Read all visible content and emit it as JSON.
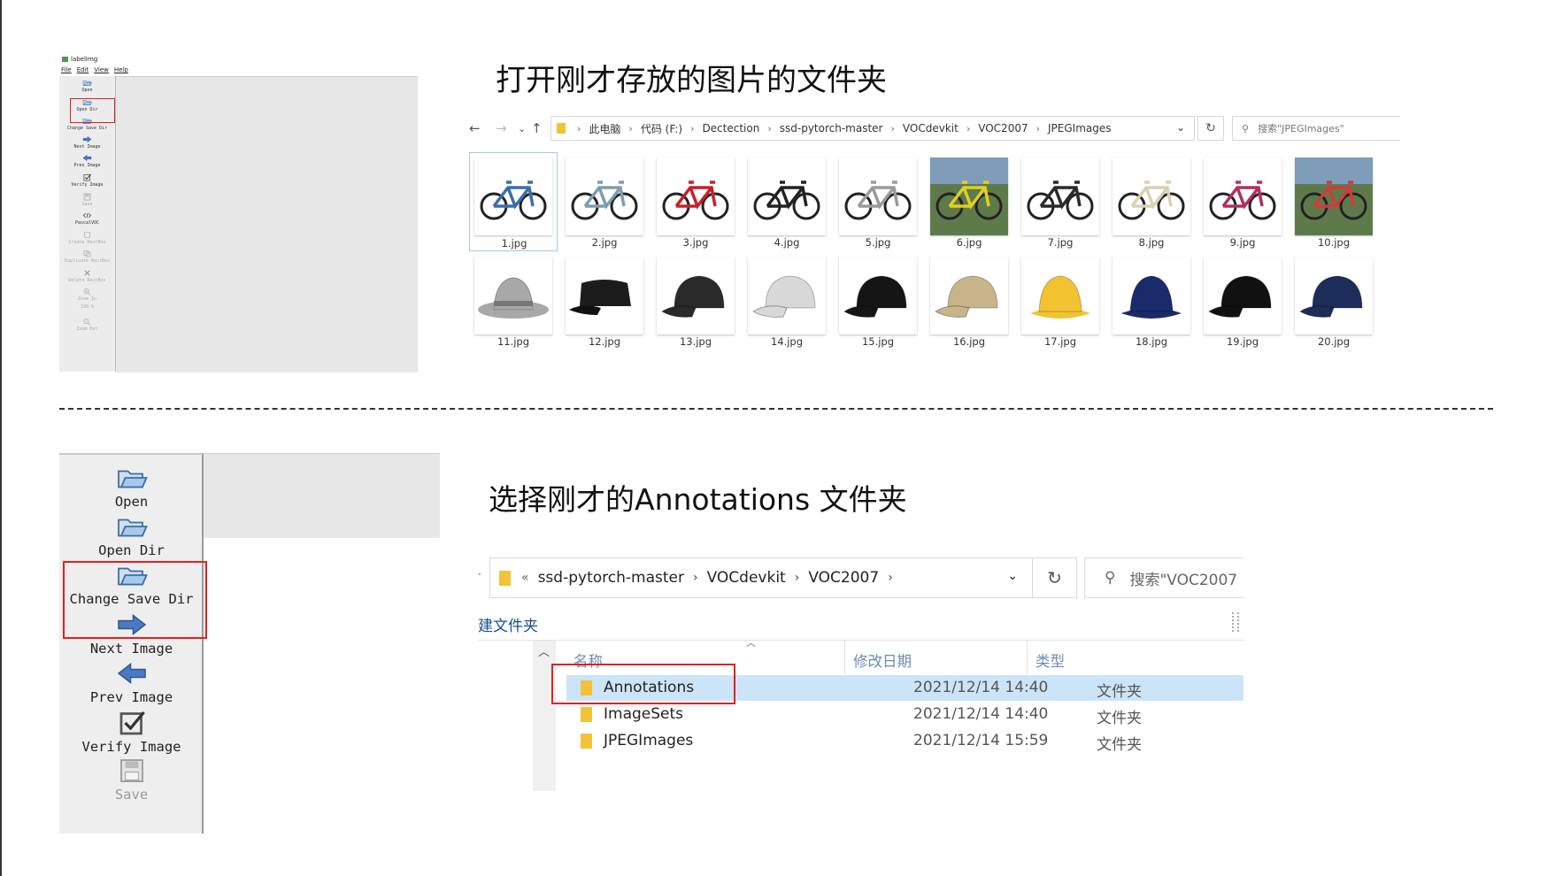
{
  "section1": {
    "heading": "打开刚才存放的图片的文件夹",
    "labelimg": {
      "title": "labelImg",
      "menu": [
        "File",
        "Edit",
        "View",
        "Help"
      ],
      "toolbar": [
        {
          "label": "Open",
          "icon": "folder-open-icon",
          "enabled": true
        },
        {
          "label": "Open Dir",
          "icon": "folder-open-icon",
          "enabled": true
        },
        {
          "label": "Change Save Dir",
          "icon": "folder-open-icon",
          "enabled": true
        },
        {
          "label": "Next Image",
          "icon": "arrow-right-icon",
          "enabled": true
        },
        {
          "label": "Prev Image",
          "icon": "arrow-left-icon",
          "enabled": true
        },
        {
          "label": "Verify Image",
          "icon": "checkbox-icon",
          "enabled": true
        },
        {
          "label": "Save",
          "icon": "save-icon",
          "enabled": false
        },
        {
          "label": "PascalVOC",
          "icon": "code-icon",
          "enabled": true
        },
        {
          "label": "Create RectBox",
          "icon": "rect-icon",
          "enabled": false
        },
        {
          "label": "Duplicate RectBox",
          "icon": "copy-icon",
          "enabled": false
        },
        {
          "label": "Delete RectBox",
          "icon": "delete-icon",
          "enabled": false
        },
        {
          "label": "Zoom In",
          "icon": "zoom-in-icon",
          "enabled": false
        },
        {
          "label": "100 %",
          "icon": "",
          "enabled": false
        },
        {
          "label": "Zoom Out",
          "icon": "zoom-out-icon",
          "enabled": false
        }
      ],
      "highlighted": "Open Dir"
    },
    "explorer": {
      "path": [
        "此电脑",
        "代码 (F:)",
        "Dectection",
        "ssd-pytorch-master",
        "VOCdevkit",
        "VOC2007",
        "JPEGImages"
      ],
      "search_placeholder": "搜索\"JPEGImages\"",
      "files": [
        {
          "name": "1.jpg",
          "kind": "bike",
          "color": "#3a6fa8"
        },
        {
          "name": "2.jpg",
          "kind": "bike",
          "color": "#7d9cb0"
        },
        {
          "name": "3.jpg",
          "kind": "bike",
          "color": "#c8202a"
        },
        {
          "name": "4.jpg",
          "kind": "bike",
          "color": "#222222"
        },
        {
          "name": "5.jpg",
          "kind": "bike",
          "color": "#9a9a9a"
        },
        {
          "name": "6.jpg",
          "kind": "bike-photo",
          "color": "#e0d020"
        },
        {
          "name": "7.jpg",
          "kind": "bike",
          "color": "#2a2a2a"
        },
        {
          "name": "8.jpg",
          "kind": "bike",
          "color": "#d8d2b4"
        },
        {
          "name": "9.jpg",
          "kind": "bike",
          "color": "#b03060"
        },
        {
          "name": "10.jpg",
          "kind": "bike-photo",
          "color": "#d03a3a"
        },
        {
          "name": "11.jpg",
          "kind": "hat-fedora",
          "color": "#a8a8a8"
        },
        {
          "name": "12.jpg",
          "kind": "cap-flat",
          "color": "#1c1c1c"
        },
        {
          "name": "13.jpg",
          "kind": "cap",
          "color": "#2a2a2a"
        },
        {
          "name": "14.jpg",
          "kind": "cap",
          "color": "#d8d8d8"
        },
        {
          "name": "15.jpg",
          "kind": "cap",
          "color": "#151515"
        },
        {
          "name": "16.jpg",
          "kind": "cap",
          "color": "#c8b48a"
        },
        {
          "name": "17.jpg",
          "kind": "hat-bucket",
          "color": "#f2c230"
        },
        {
          "name": "18.jpg",
          "kind": "hat-bucket",
          "color": "#1a2a6a"
        },
        {
          "name": "19.jpg",
          "kind": "cap",
          "color": "#111111"
        },
        {
          "name": "20.jpg",
          "kind": "cap",
          "color": "#1d2d5a"
        }
      ],
      "selected": "1.jpg"
    }
  },
  "section2": {
    "heading": "选择刚才的Annotations 文件夹",
    "labelimg_toolbar": [
      {
        "label": "Open",
        "icon": "folder-open-icon",
        "enabled": true
      },
      {
        "label": "Open Dir",
        "icon": "folder-open-icon",
        "enabled": true
      },
      {
        "label": "Change Save Dir",
        "icon": "folder-open-icon",
        "enabled": true
      },
      {
        "label": "Next Image",
        "icon": "arrow-right-icon",
        "enabled": true
      },
      {
        "label": "Prev Image",
        "icon": "arrow-left-icon",
        "enabled": true
      },
      {
        "label": "Verify Image",
        "icon": "checkbox-icon",
        "enabled": true
      },
      {
        "label": "Save",
        "icon": "save-icon",
        "enabled": false
      }
    ],
    "highlighted": "Change Save Dir",
    "explorer": {
      "path": [
        "ssd-pytorch-master",
        "VOCdevkit",
        "VOC2007"
      ],
      "path_prefix": "«",
      "search_placeholder": "搜索\"VOC2007",
      "new_folder": "建文件夹",
      "columns": {
        "name": "名称",
        "date": "修改日期",
        "type": "类型"
      },
      "rows": [
        {
          "name": "Annotations",
          "date": "2021/12/14 14:40",
          "type": "文件夹",
          "selected": true
        },
        {
          "name": "ImageSets",
          "date": "2021/12/14 14:40",
          "type": "文件夹",
          "selected": false
        },
        {
          "name": "JPEGImages",
          "date": "2021/12/14 15:59",
          "type": "文件夹",
          "selected": false
        }
      ]
    }
  }
}
